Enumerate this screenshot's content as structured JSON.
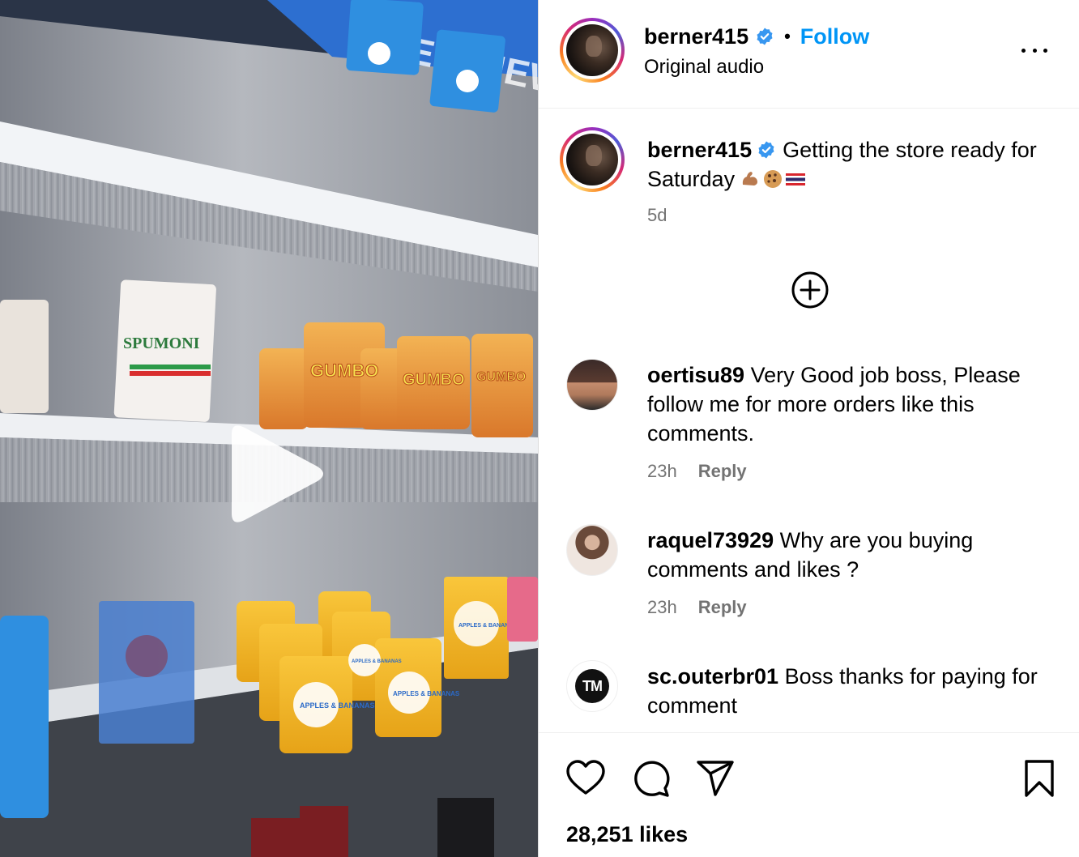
{
  "post": {
    "author": "berner415",
    "follow_label": "Follow",
    "audio_label": "Original audio",
    "caption_text": "Getting the store ready for Saturday",
    "caption_emojis": [
      "flexed-biceps",
      "cookie",
      "thailand-flag"
    ],
    "caption_time": "5d",
    "likes_label": "28,251 likes"
  },
  "comments": [
    {
      "username": "oertisu89",
      "text": "Very Good job boss, Please follow me for more orders like this comments.",
      "time": "23h",
      "reply_label": "Reply"
    },
    {
      "username": "raquel73929",
      "text": "Why are you buying comments and likes ?",
      "time": "23h",
      "reply_label": "Reply"
    },
    {
      "username": "sc.outerbr01",
      "text": "Boss thanks for paying for comment",
      "avatar_text": "TM"
    }
  ],
  "media": {
    "shelf_banner": "NEW NEW",
    "product_labels": [
      "SPUMONI",
      "GUMBO",
      "GUMBO",
      "GUMBO",
      "APPLES & BANANAS",
      "APPLES & BANANAS",
      "APPLES & BANANAS",
      "APPLES & BANANAS"
    ]
  },
  "icons": {
    "verified": "verified-badge-icon",
    "more": "more-options-icon",
    "load_more": "load-more-comments-icon",
    "like": "heart-icon",
    "comment": "comment-bubble-icon",
    "share": "paper-plane-icon",
    "save": "bookmark-icon",
    "play": "play-icon"
  },
  "colors": {
    "follow_blue": "#0095f6",
    "verified_blue": "#3897f0",
    "muted_text": "#737373"
  }
}
